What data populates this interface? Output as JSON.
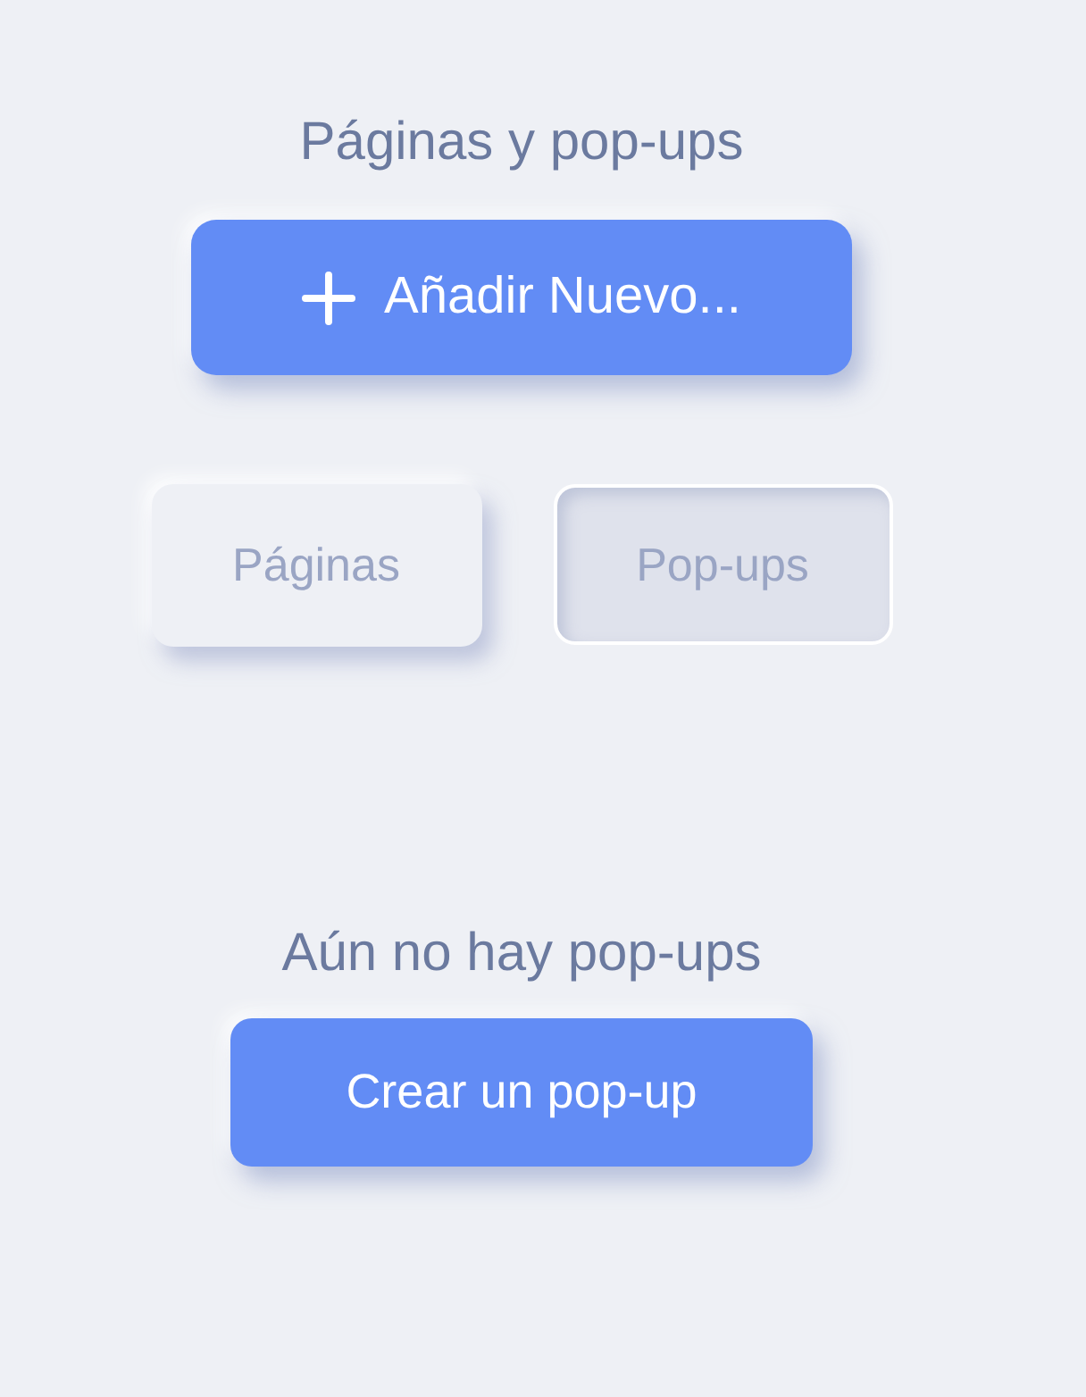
{
  "header": {
    "title": "Páginas y pop-ups"
  },
  "add_button": {
    "label": "Añadir Nuevo..."
  },
  "tabs": [
    {
      "label": "Páginas",
      "selected": false
    },
    {
      "label": "Pop-ups",
      "selected": true
    }
  ],
  "empty_state": {
    "message": "Aún no hay pop-ups",
    "button": "Crear un pop-up"
  }
}
